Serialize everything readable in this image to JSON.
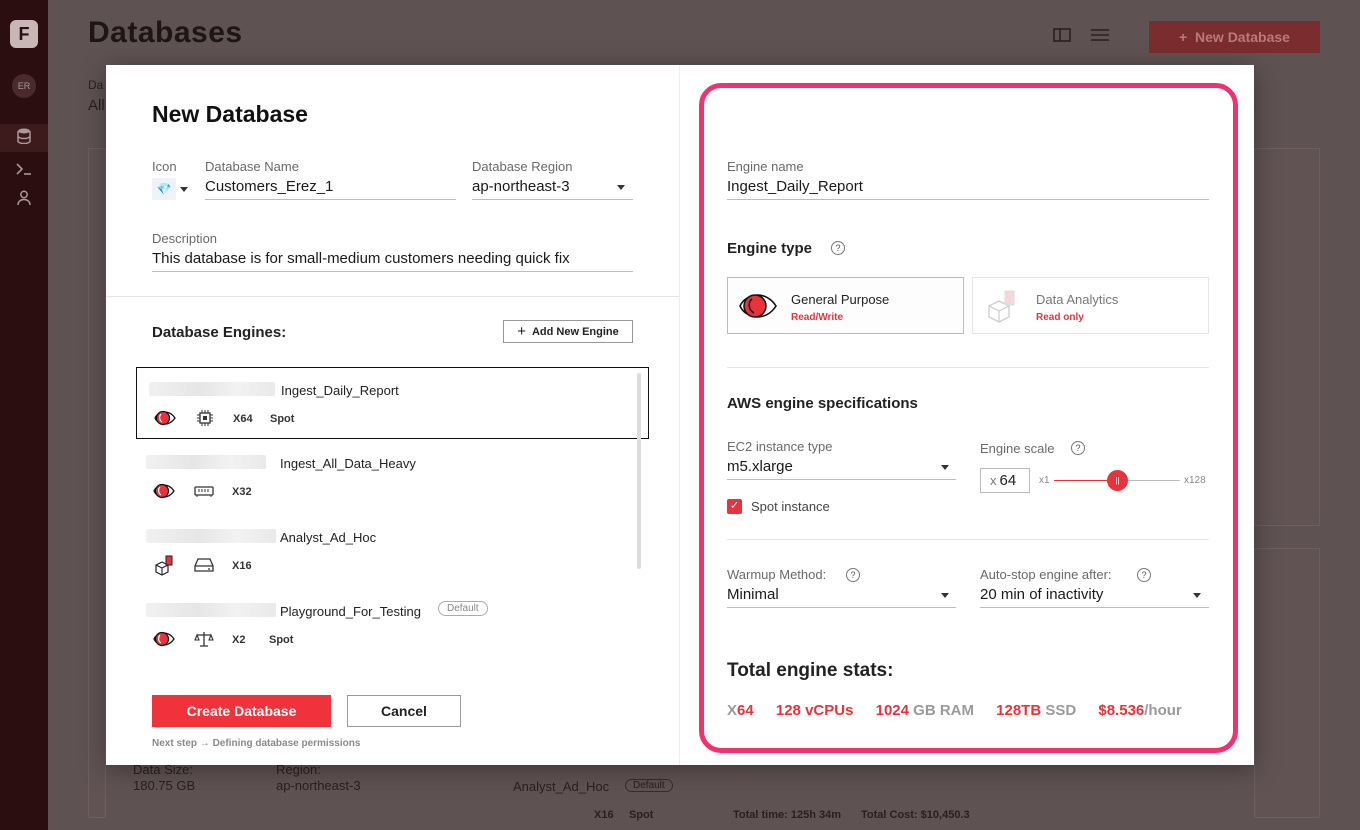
{
  "app": {
    "title": "Databases",
    "new_database_button": "New Database",
    "sidebar_avatar": "ER",
    "bg_filter_label": "Da",
    "bg_filter_value": "All",
    "bg_data_size_label": "Data Size:",
    "bg_data_size_value": "180.75 GB",
    "bg_region_label": "Region:",
    "bg_region_value": "ap-northeast-3",
    "bg_engine_name": "Analyst_Ad_Hoc",
    "bg_engine_badge": "Default",
    "bg_engine_scale": "X16",
    "bg_engine_spot": "Spot",
    "bg_total_time": "Total time: 125h 34m",
    "bg_total_cost": "Total Cost: $10,450.3"
  },
  "modal": {
    "title": "New Database",
    "icon_label": "Icon",
    "icon_value": "💎",
    "name_label": "Database Name",
    "name_value": "Customers_Erez_1",
    "region_label": "Database Region",
    "region_value": "ap-northeast-3",
    "description_label": "Description",
    "description_value": "This database is for small-medium customers needing quick fix",
    "engines_heading": "Database Engines:",
    "add_engine_label": "Add New Engine",
    "engines": [
      {
        "name": "Ingest_Daily_Report",
        "scale": "X64",
        "spot": "Spot",
        "badge": "",
        "type": "general",
        "size_icon": "cpu"
      },
      {
        "name": "Ingest_All_Data_Heavy",
        "scale": "X32",
        "spot": "",
        "badge": "",
        "type": "general",
        "size_icon": "ram"
      },
      {
        "name": "Analyst_Ad_Hoc",
        "scale": "X16",
        "spot": "",
        "badge": "",
        "type": "analytics",
        "size_icon": "disk"
      },
      {
        "name": "Playground_For_Testing",
        "scale": "X2",
        "spot": "Spot",
        "badge": "Default",
        "type": "general",
        "size_icon": "balance"
      }
    ],
    "create_label": "Create Database",
    "cancel_label": "Cancel",
    "next_step": "Next step → Defining database permissions"
  },
  "engine_form": {
    "name_label": "Engine name",
    "name_value": "Ingest_Daily_Report",
    "type_heading": "Engine type",
    "types": [
      {
        "title": "General Purpose",
        "subtitle": "Read/Write",
        "selected": true
      },
      {
        "title": "Data Analytics",
        "subtitle": "Read only",
        "selected": false
      }
    ],
    "specs_heading": "AWS engine specifications",
    "ec2_label": "EC2 instance type",
    "ec2_value": "m5.xlarge",
    "spot_label": "Spot instance",
    "spot_checked": true,
    "scale_label": "Engine scale",
    "scale_prefix": "x",
    "scale_value": "64",
    "slider_min": "x1",
    "slider_max": "x128",
    "slider_fraction": 0.5,
    "warmup_label": "Warmup Method:",
    "warmup_value": "Minimal",
    "autostop_label": "Auto-stop engine after:",
    "autostop_value": "20 min of inactivity",
    "stats_heading": "Total engine stats:",
    "stats": {
      "scale_prefix": "X",
      "scale": "64",
      "vcpus": "128",
      "vcpus_unit": "vCPUs",
      "ram": "1024",
      "ram_unit": "GB RAM",
      "ssd": "128TB",
      "ssd_unit": "SSD",
      "cost": "$8.536",
      "cost_unit": "/hour"
    }
  },
  "colors": {
    "accent_red": "#e8323c",
    "highlight_pink": "#f0326e"
  }
}
